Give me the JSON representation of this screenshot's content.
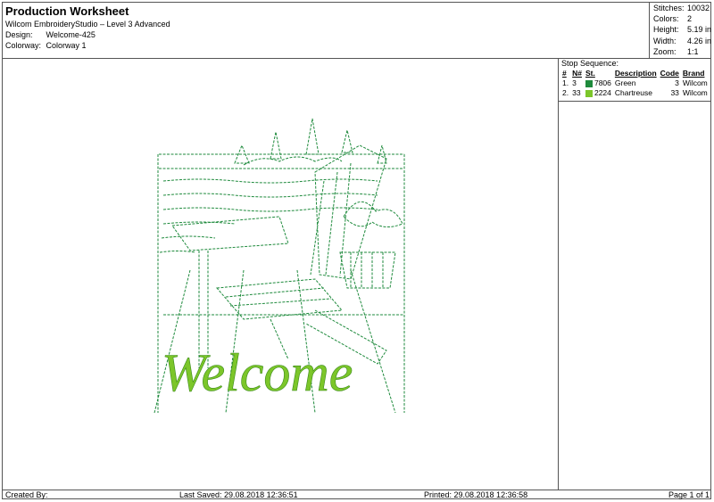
{
  "header": {
    "title": "Production Worksheet",
    "software": "Wilcom EmbroideryStudio – Level 3 Advanced",
    "design_label": "Design:",
    "design_value": "Welcome-425",
    "colorway_label": "Colorway:",
    "colorway_value": "Colorway 1"
  },
  "stats": [
    {
      "label": "Stitches:",
      "value": "10032"
    },
    {
      "label": "Colors:",
      "value": "2"
    },
    {
      "label": "Height:",
      "value": "5.19 in"
    },
    {
      "label": "Width:",
      "value": "4.26 in"
    },
    {
      "label": "Zoom:",
      "value": "1:1"
    }
  ],
  "stop_sequence": {
    "title": "Stop Sequence:",
    "columns": [
      "#",
      "N#",
      "St.",
      "Description",
      "Code",
      "Brand"
    ],
    "rows": [
      {
        "num": "1.",
        "n": "3",
        "color": "#1e8a3c",
        "st": "7806",
        "description": "Green",
        "code": "3",
        "brand": "Wilcom"
      },
      {
        "num": "2.",
        "n": "33",
        "color": "#7cc62a",
        "st": "2224",
        "description": "Chartreuse",
        "code": "33",
        "brand": "Wilcom"
      }
    ]
  },
  "design_preview": {
    "text": "Welcome",
    "outline_color": "#1e8a3c",
    "lettering_color": "#7cc62a"
  },
  "footer": {
    "created_by": "Created By:",
    "last_saved": "Last Saved: 29.08.2018 12:36:51",
    "printed": "Printed: 29.08.2018 12:36:58",
    "page": "Page 1 of 1"
  }
}
